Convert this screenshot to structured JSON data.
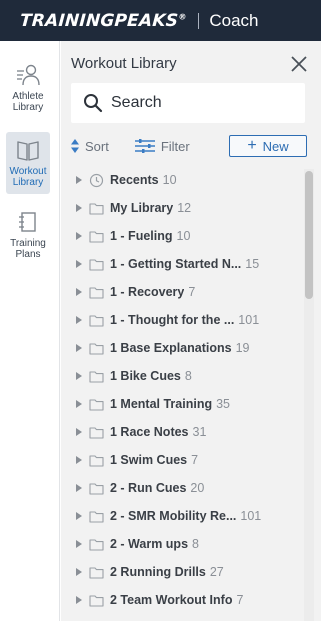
{
  "header": {
    "brand": "TRAININGPEAKS",
    "trademark": "®",
    "section": "Coach"
  },
  "rail": [
    {
      "label": "Athlete Library",
      "icon": "athlete-library-icon",
      "active": false
    },
    {
      "label": "Workout Library",
      "icon": "workout-library-icon",
      "active": true
    },
    {
      "label": "Training Plans",
      "icon": "training-plans-icon",
      "active": false
    }
  ],
  "panel": {
    "title": "Workout Library",
    "search_placeholder": "Search",
    "sort_label": "Sort",
    "filter_label": "Filter",
    "new_label": "New"
  },
  "folders": [
    {
      "name": "Recents",
      "count": "10",
      "icon": "clock-icon"
    },
    {
      "name": "My Library",
      "count": "12",
      "icon": "folder-icon"
    },
    {
      "name": "1 - Fueling",
      "count": "10",
      "icon": "folder-icon"
    },
    {
      "name": "1 - Getting Started N...",
      "count": "15",
      "icon": "folder-icon"
    },
    {
      "name": "1 - Recovery",
      "count": "7",
      "icon": "folder-icon"
    },
    {
      "name": "1 - Thought for the ...",
      "count": "101",
      "icon": "folder-icon"
    },
    {
      "name": "1 Base Explanations",
      "count": "19",
      "icon": "folder-icon"
    },
    {
      "name": "1 Bike Cues",
      "count": "8",
      "icon": "folder-icon"
    },
    {
      "name": "1 Mental Training",
      "count": "35",
      "icon": "folder-icon"
    },
    {
      "name": "1 Race Notes",
      "count": "31",
      "icon": "folder-icon"
    },
    {
      "name": "1 Swim Cues",
      "count": "7",
      "icon": "folder-icon"
    },
    {
      "name": "2 - Run Cues",
      "count": "20",
      "icon": "folder-icon"
    },
    {
      "name": "2 - SMR Mobility Re...",
      "count": "101",
      "icon": "folder-icon"
    },
    {
      "name": "2 - Warm ups",
      "count": "8",
      "icon": "folder-icon"
    },
    {
      "name": "2 Running Drills",
      "count": "27",
      "icon": "folder-icon"
    },
    {
      "name": "2 Team Workout Info",
      "count": "7",
      "icon": "folder-icon"
    }
  ],
  "colors": {
    "topbar": "#1f2a3a",
    "accent": "#2d6db3",
    "panel_bg": "#f2f2f2"
  }
}
